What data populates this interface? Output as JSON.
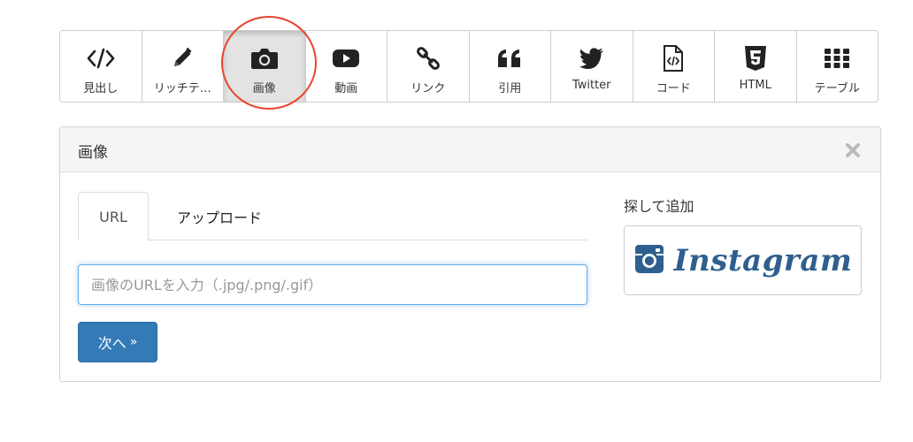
{
  "toolbar": {
    "items": [
      {
        "label": "見出し",
        "icon": "code-icon"
      },
      {
        "label": "リッチテ…",
        "icon": "pencil-icon"
      },
      {
        "label": "画像",
        "icon": "camera-icon"
      },
      {
        "label": "動画",
        "icon": "youtube-icon"
      },
      {
        "label": "リンク",
        "icon": "link-icon"
      },
      {
        "label": "引用",
        "icon": "quote-icon"
      },
      {
        "label": "Twitter",
        "icon": "twitter-icon"
      },
      {
        "label": "コード",
        "icon": "code-file-icon"
      },
      {
        "label": "HTML",
        "icon": "html5-icon"
      },
      {
        "label": "テーブル",
        "icon": "grid-icon"
      }
    ],
    "active": "画像"
  },
  "panel": {
    "title": "画像",
    "tabs": {
      "url": "URL",
      "upload": "アップロード"
    },
    "input": {
      "value": "",
      "placeholder": "画像のURLを入力（.jpg/.png/.gif）"
    },
    "next_label": "次へ",
    "next_glyph": "»",
    "search_label": "探して追加",
    "instagram_label": "Instagram"
  },
  "colors": {
    "accent": "#337ab7",
    "annotation": "#e8452c",
    "instagram": "#2f5f8f"
  }
}
